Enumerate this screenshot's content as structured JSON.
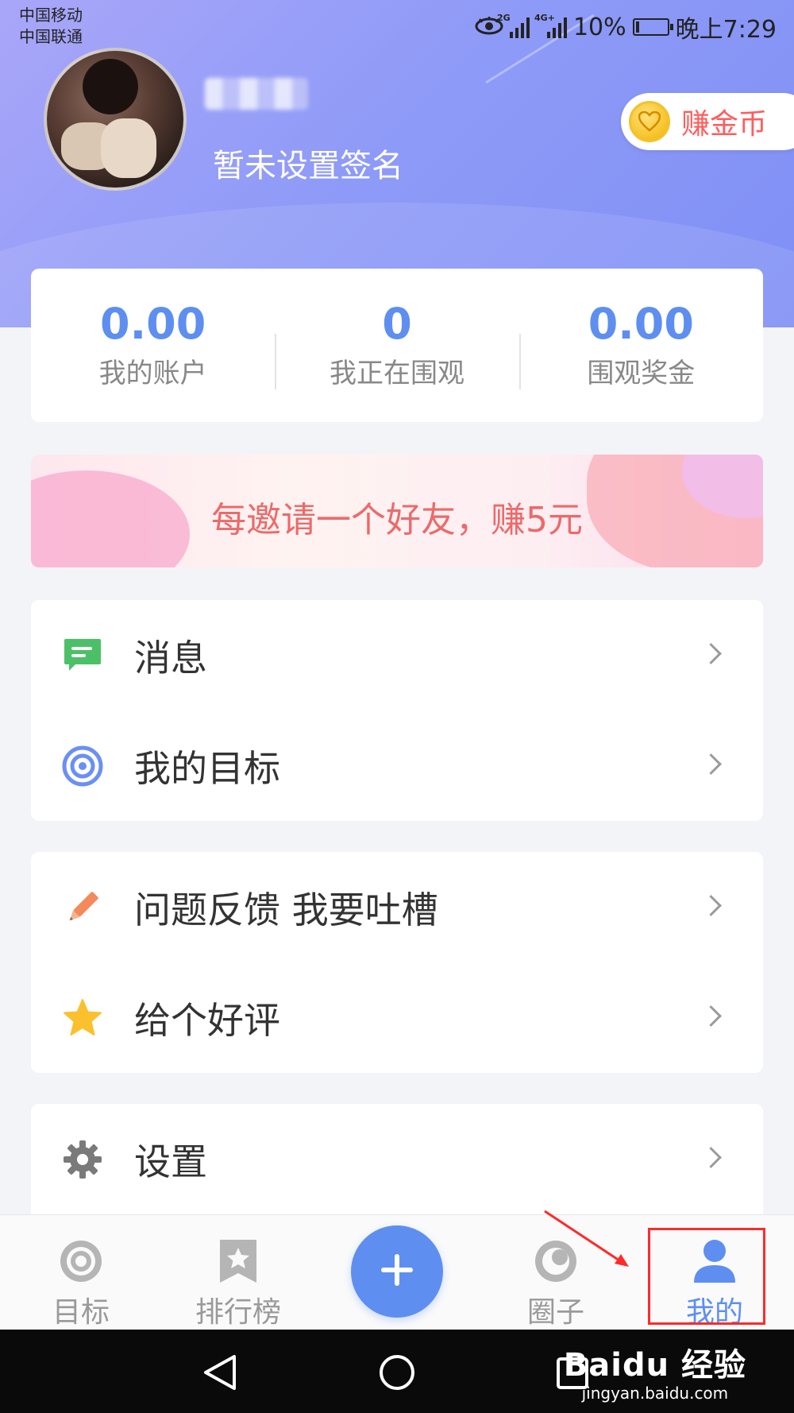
{
  "status_bar": {
    "carrier_1": "中国移动",
    "carrier_2": "中国联通",
    "net_1": "2G",
    "net_2": "4G+",
    "battery": "10%",
    "time": "晚上7:29"
  },
  "profile": {
    "signature": "暂未设置签名",
    "earn_coins_label": "赚金币"
  },
  "stats": [
    {
      "value": "0.00",
      "label": "我的账户"
    },
    {
      "value": "0",
      "label": "我正在围观"
    },
    {
      "value": "0.00",
      "label": "围观奖金"
    }
  ],
  "invite_banner": {
    "text": "每邀请一个好友，赚5元"
  },
  "menu": {
    "messages": "消息",
    "my_goals": "我的目标",
    "feedback": "问题反馈 我要吐槽",
    "rate": "给个好评",
    "settings": "设置"
  },
  "tabs": [
    {
      "label": "目标",
      "icon": "target-icon"
    },
    {
      "label": "排行榜",
      "icon": "ranking-icon"
    },
    {
      "label": "圈子",
      "icon": "circle-icon"
    },
    {
      "label": "我的",
      "icon": "person-icon",
      "active": true
    }
  ],
  "fab_icon": "plus-icon",
  "watermark": {
    "brand": "Baidu 经验",
    "url": "jingyan.baidu.com"
  },
  "colors": {
    "accent": "#5e8ff0",
    "hero_gradient_start": "#a9a6f9",
    "hero_gradient_end": "#7f8ff5",
    "coin_label": "#ff5c5c",
    "invite_text": "#ec6a6a",
    "annotation": "#ff2a2a"
  }
}
